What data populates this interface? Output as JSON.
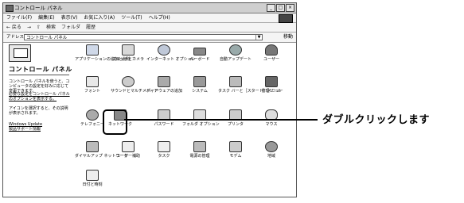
{
  "window": {
    "title": "コントロール パネル",
    "buttons": [
      "_",
      "□",
      "×"
    ]
  },
  "menu": [
    "ファイル(F)",
    "編集(E)",
    "表示(V)",
    "お気に入り(A)",
    "ツール(T)",
    "ヘルプ(H)"
  ],
  "toolbar": [
    "← 戻る",
    "→",
    "⇧",
    "検索",
    "フォルダ",
    "履歴"
  ],
  "address": {
    "label": "アドレス(D)",
    "value": "コントロール パネル",
    "go": "移動"
  },
  "sidebar": {
    "title": "コントロール パネル",
    "desc1": "コントロール パネルを使うと、コンピュータの設定を好みに応じて変更できます。",
    "desc2": "必要な設定をコントロール パネルのオプションを表示する。",
    "desc3": "アイコンを選択すると、その説明が表示されます。",
    "link1": "Windows Update",
    "link2": "製品サポート情報"
  },
  "items": [
    {
      "label": "アプリケーションの追加と削除",
      "icon": "add-remove-programs-icon"
    },
    {
      "label": "スキャナとカメラ",
      "icon": "scanner-camera-icon"
    },
    {
      "label": "インターネット オプション",
      "icon": "internet-options-icon"
    },
    {
      "label": "キーボード",
      "icon": "keyboard-icon"
    },
    {
      "label": "自動アップデート",
      "icon": "automatic-updates-icon"
    },
    {
      "label": "ユーザー",
      "icon": "users-icon"
    },
    {
      "label": "フォント",
      "icon": "fonts-icon"
    },
    {
      "label": "サウンドとマルチメディア",
      "icon": "sound-multimedia-icon"
    },
    {
      "label": "ハードウェアの追加",
      "icon": "add-hardware-icon"
    },
    {
      "label": "システム",
      "icon": "system-icon"
    },
    {
      "label": "タスク バーと［スタート］メニュー",
      "icon": "taskbar-start-icon"
    },
    {
      "label": "管理ツール",
      "icon": "admin-tools-icon"
    },
    {
      "label": "テレフォニー",
      "icon": "telephony-icon"
    },
    {
      "label": "ネットワーク",
      "icon": "network-icon"
    },
    {
      "label": "パスワード",
      "icon": "passwords-icon"
    },
    {
      "label": "フォルダ オプション",
      "icon": "folder-options-icon"
    },
    {
      "label": "プリンタ",
      "icon": "printers-icon"
    },
    {
      "label": "マウス",
      "icon": "mouse-icon"
    },
    {
      "label": "ダイヤルアップ ネットワーク",
      "icon": "dialup-network-icon"
    },
    {
      "label": "ユーザー補助",
      "icon": "accessibility-icon"
    },
    {
      "label": "タスク",
      "icon": "scheduled-tasks-icon"
    },
    {
      "label": "電源の管理",
      "icon": "power-management-icon"
    },
    {
      "label": "モデム",
      "icon": "modem-icon"
    },
    {
      "label": "地域",
      "icon": "regional-icon"
    },
    {
      "label": "日付と時刻",
      "icon": "date-time-icon"
    }
  ],
  "callout": "ダブルクリックします"
}
